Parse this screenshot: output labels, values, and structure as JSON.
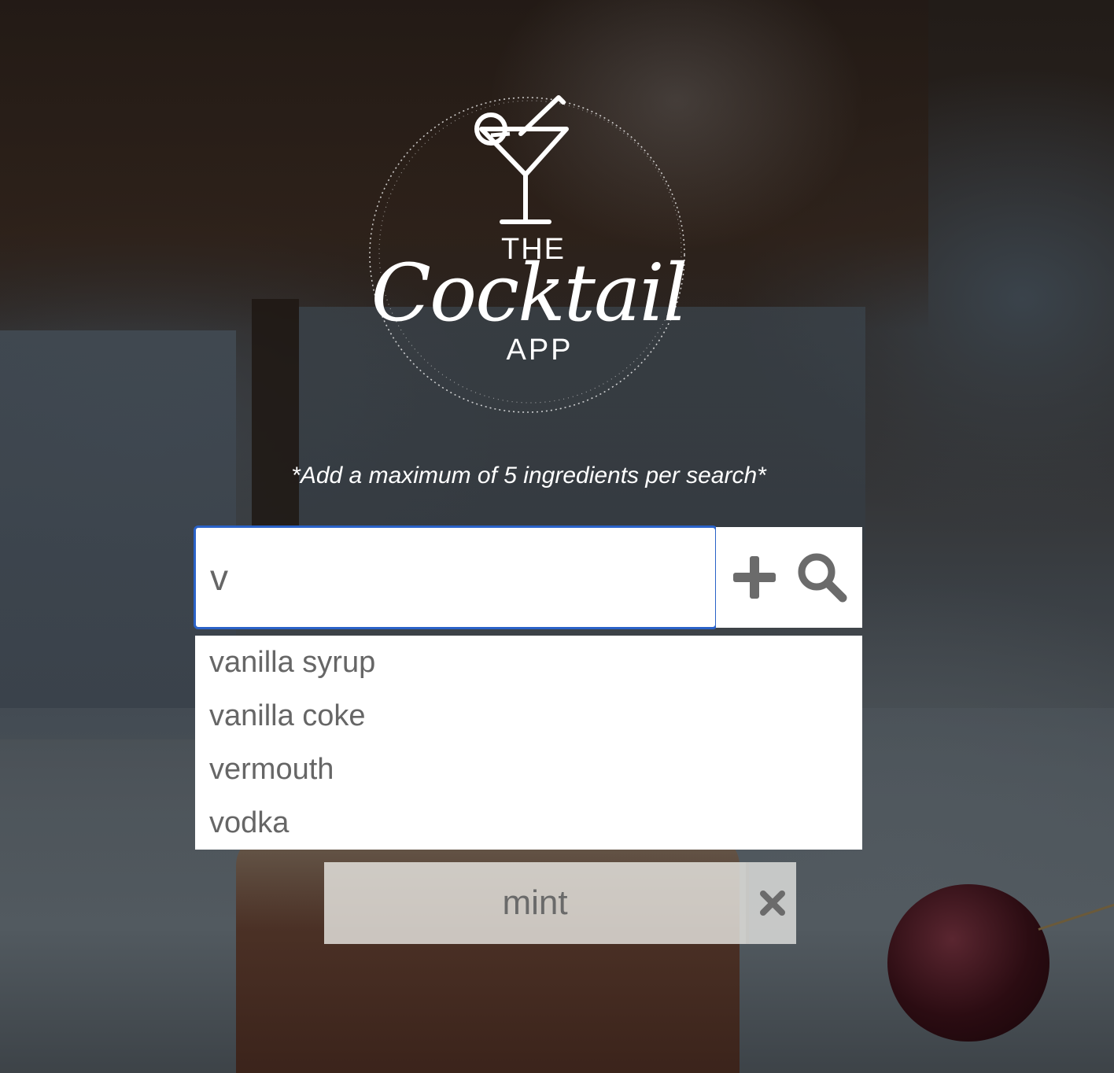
{
  "logo": {
    "line1": "THE",
    "line2": "Cocktail",
    "line3": "APP"
  },
  "hint": "*Add a maximum of 5 ingredients per search*",
  "search": {
    "value": "v",
    "placeholder": ""
  },
  "icons": {
    "add": "plus-icon",
    "search": "magnifier-icon",
    "remove": "close-icon"
  },
  "suggestions": [
    "vanilla syrup",
    "vanilla coke",
    "vermouth",
    "vodka"
  ],
  "chips": [
    {
      "label": "mint"
    }
  ],
  "colors": {
    "focus_border": "#2a62c8",
    "icon": "#6b6b6b",
    "text_muted": "#666666"
  }
}
